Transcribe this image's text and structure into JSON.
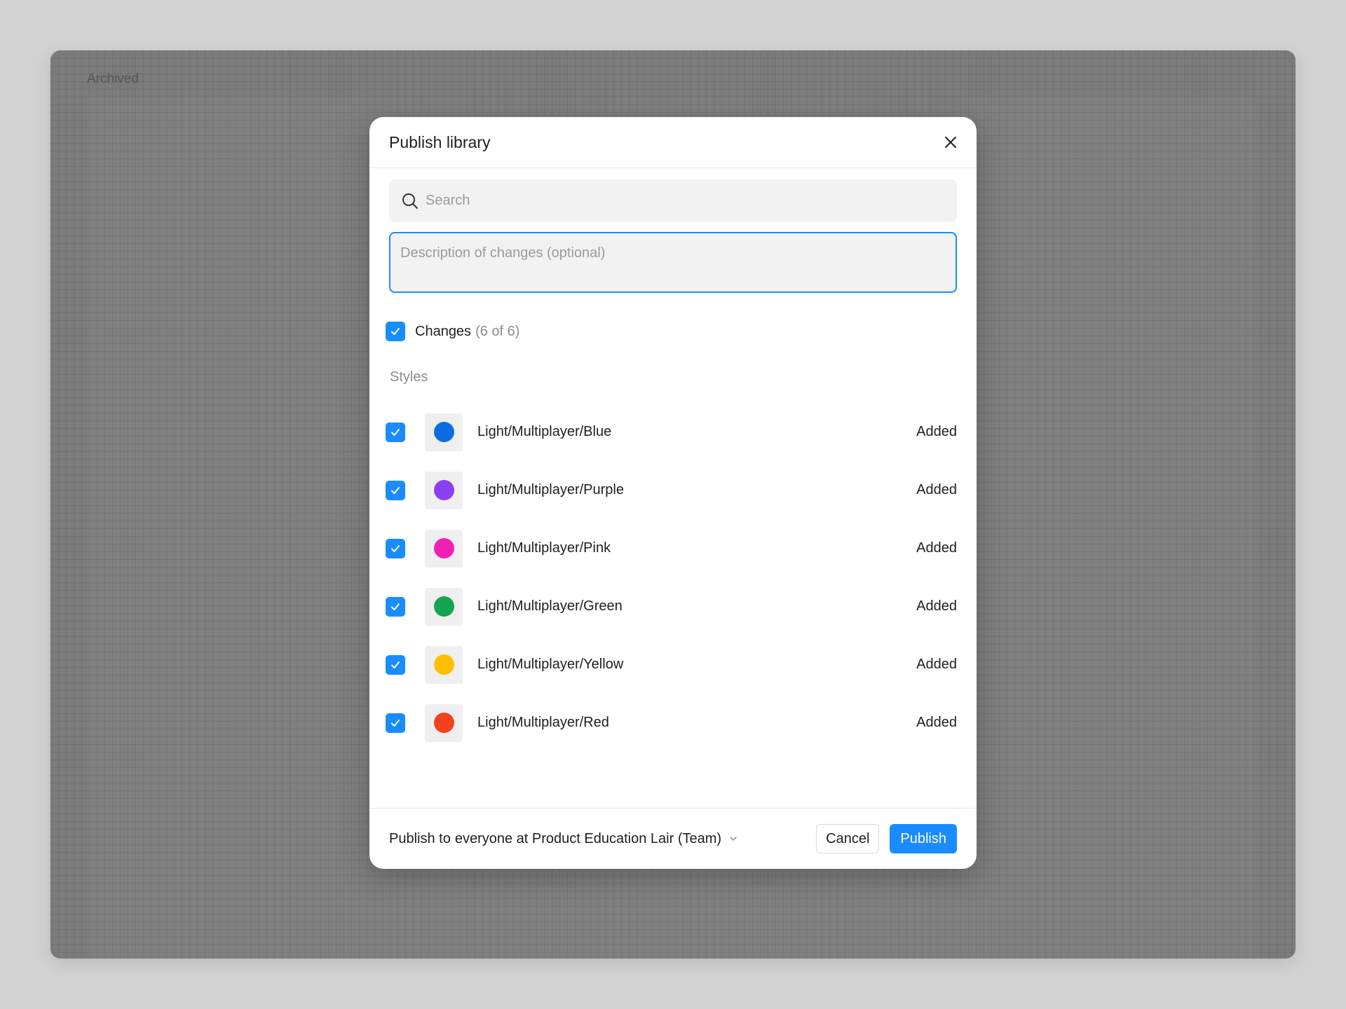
{
  "background": {
    "archived_label": "Archived"
  },
  "modal": {
    "title": "Publish library",
    "close_icon": "close-icon",
    "search": {
      "placeholder": "Search",
      "value": "",
      "icon": "search-icon"
    },
    "description": {
      "placeholder": "Description of changes (optional)",
      "value": ""
    },
    "changes": {
      "label": "Changes",
      "count": "(6 of 6)",
      "checked": true
    },
    "styles_heading": "Styles",
    "styles": [
      {
        "name": "Light/Multiplayer/Blue",
        "status": "Added",
        "color": "#0d6ce2",
        "checked": true
      },
      {
        "name": "Light/Multiplayer/Purple",
        "status": "Added",
        "color": "#8a3ff2",
        "checked": true
      },
      {
        "name": "Light/Multiplayer/Pink",
        "status": "Added",
        "color": "#f21fb4",
        "checked": true
      },
      {
        "name": "Light/Multiplayer/Green",
        "status": "Added",
        "color": "#14a553",
        "checked": true
      },
      {
        "name": "Light/Multiplayer/Yellow",
        "status": "Added",
        "color": "#ffbf00",
        "checked": true
      },
      {
        "name": "Light/Multiplayer/Red",
        "status": "Added",
        "color": "#f2411d",
        "checked": true
      }
    ],
    "footer": {
      "publish_to_prefix": "Publish to",
      "publish_to_target": "everyone at Product Education Lair (Team)",
      "dropdown_icon": "chevron-down-icon",
      "cancel_label": "Cancel",
      "publish_label": "Publish"
    }
  },
  "colors": {
    "accent": "#1a8cff",
    "overlay": "#7b7b7b",
    "page_background": "#d2d2d2"
  }
}
